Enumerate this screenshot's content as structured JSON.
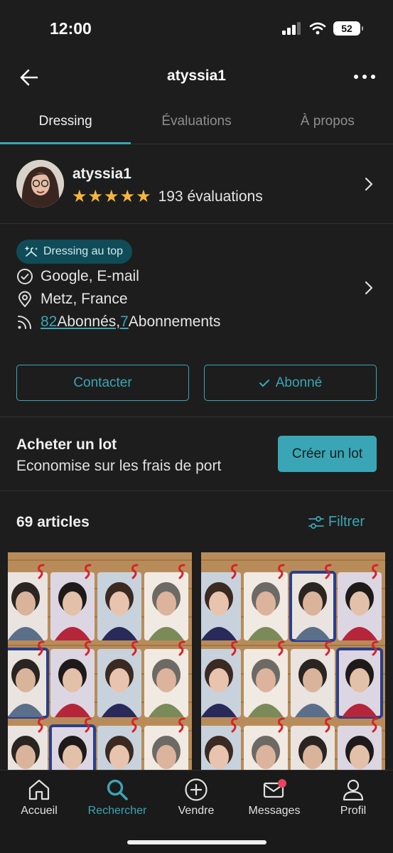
{
  "status_bar": {
    "time": "12:00",
    "battery": "52"
  },
  "header": {
    "title": "atyssia1"
  },
  "tabs": [
    {
      "label": "Dressing",
      "active": true
    },
    {
      "label": "Évaluations",
      "active": false
    },
    {
      "label": "À propos",
      "active": false
    }
  ],
  "profile": {
    "username": "atyssia1",
    "stars": "★★★★★",
    "rating": 5,
    "reviews": "193 évaluations"
  },
  "info": {
    "badge": "Dressing au top",
    "verified": "Google, E-mail",
    "location": "Metz, France",
    "followers_count": "82",
    "followers_label": " Abonnés, ",
    "following_count": "7",
    "following_label": " Abonnements"
  },
  "actions": {
    "contact": "Contacter",
    "following": "Abonné"
  },
  "bundle": {
    "title": "Acheter un lot",
    "subtitle": "Economise sur les frais de port",
    "button": "Créer un lot"
  },
  "listing": {
    "count": "69 articles",
    "filter": "Filtrer"
  },
  "nav": [
    {
      "label": "Accueil",
      "icon": "home-icon",
      "active": false
    },
    {
      "label": "Rechercher",
      "icon": "search-icon",
      "active": true
    },
    {
      "label": "Vendre",
      "icon": "plus-circle-icon",
      "active": false
    },
    {
      "label": "Messages",
      "icon": "mail-icon",
      "active": false,
      "notification": true
    },
    {
      "label": "Profil",
      "icon": "user-icon",
      "active": false
    }
  ],
  "colors": {
    "accent": "#3aa6b5",
    "star": "#f4b73a",
    "background": "#1d1d1d",
    "badge_bg": "#0f4c57",
    "notification": "#e8455f"
  }
}
